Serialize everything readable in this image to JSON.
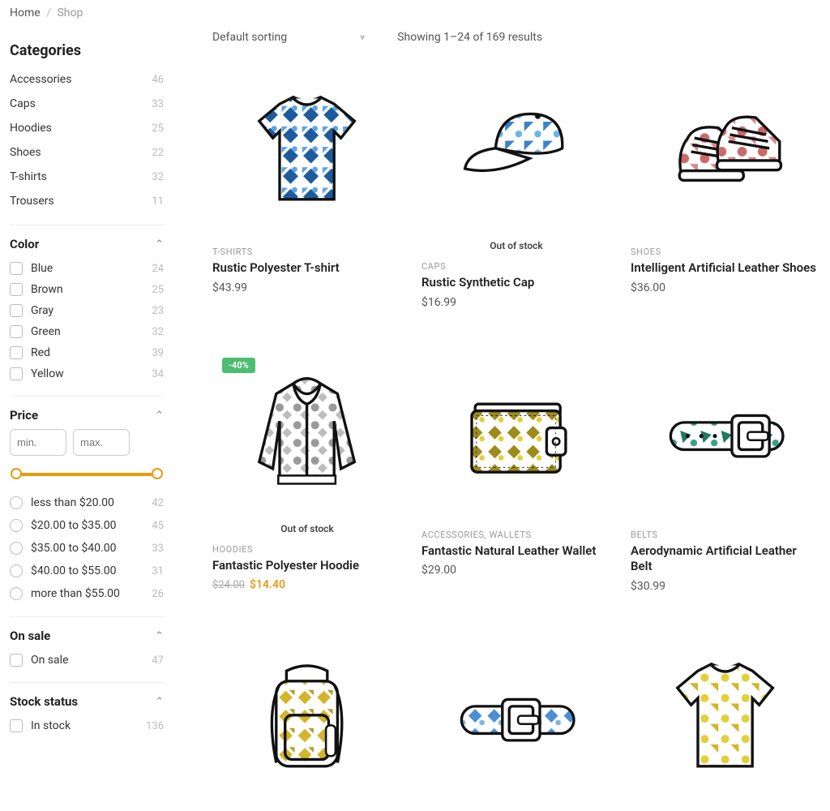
{
  "breadcrumb": {
    "home": "Home",
    "current": "Shop"
  },
  "sidebar": {
    "categories_title": "Categories",
    "categories": [
      {
        "name": "Accessories",
        "count": "46"
      },
      {
        "name": "Caps",
        "count": "33"
      },
      {
        "name": "Hoodies",
        "count": "25"
      },
      {
        "name": "Shoes",
        "count": "22"
      },
      {
        "name": "T-shirts",
        "count": "32"
      },
      {
        "name": "Trousers",
        "count": "11"
      }
    ],
    "color_title": "Color",
    "colors": [
      {
        "name": "Blue",
        "count": "24"
      },
      {
        "name": "Brown",
        "count": "25"
      },
      {
        "name": "Gray",
        "count": "23"
      },
      {
        "name": "Green",
        "count": "32"
      },
      {
        "name": "Red",
        "count": "39"
      },
      {
        "name": "Yellow",
        "count": "34"
      }
    ],
    "price_title": "Price",
    "price_min_placeholder": "min.",
    "price_max_placeholder": "max.",
    "price_ranges": [
      {
        "label": "less than $20.00",
        "count": "42"
      },
      {
        "label": "$20.00 to $35.00",
        "count": "45"
      },
      {
        "label": "$35.00 to $40.00",
        "count": "33"
      },
      {
        "label": "$40.00 to $55.00",
        "count": "31"
      },
      {
        "label": "more than $55.00",
        "count": "26"
      }
    ],
    "onsale_title": "On sale",
    "onsale_label": "On sale",
    "onsale_count": "47",
    "stock_title": "Stock status",
    "stock_label": "In stock",
    "stock_count": "136"
  },
  "toolbar": {
    "sort_label": "Default sorting",
    "results_text": "Showing 1–24 of 169 results"
  },
  "products": [
    {
      "cat": "T-SHIRTS",
      "name": "Rustic Polyester T-shirt",
      "price": "$43.99",
      "badge": "",
      "old": "",
      "sale": "",
      "oos": ""
    },
    {
      "cat": "CAPS",
      "name": "Rustic Synthetic Cap",
      "price": "$16.99",
      "badge": "",
      "old": "",
      "sale": "",
      "oos": "Out of stock"
    },
    {
      "cat": "SHOES",
      "name": "Intelligent Artificial Leather Shoes",
      "price": "$36.00",
      "badge": "",
      "old": "",
      "sale": "",
      "oos": ""
    },
    {
      "cat": "HOODIES",
      "name": "Fantastic Polyester Hoodie",
      "price": "",
      "badge": "-40%",
      "old": "$24.00",
      "sale": "$14.40",
      "oos": "Out of stock"
    },
    {
      "cat": "ACCESSORIES,  WALLETS",
      "name": "Fantastic Natural Leather Wallet",
      "price": "$29.00",
      "badge": "",
      "old": "",
      "sale": "",
      "oos": ""
    },
    {
      "cat": "BELTS",
      "name": "Aerodynamic Artificial Leather Belt",
      "price": "$30.99",
      "badge": "",
      "old": "",
      "sale": "",
      "oos": ""
    }
  ]
}
